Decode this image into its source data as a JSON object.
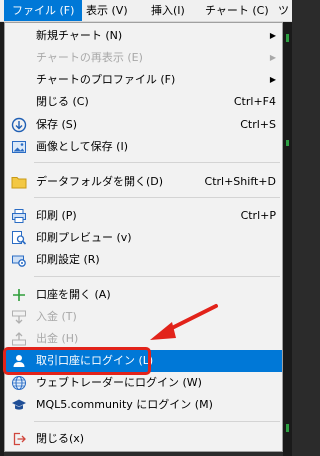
{
  "menubar": {
    "items": [
      {
        "label": "ファイル (F)",
        "active": true
      },
      {
        "label": "表示 (V)"
      },
      {
        "label": "挿入(I)"
      },
      {
        "label": "チャート (C)"
      },
      {
        "label": "ツ"
      }
    ]
  },
  "file_menu": {
    "new_chart": "新規チャート (N)",
    "chart_redisplay": "チャートの再表示 (E)",
    "chart_profile": "チャートのプロファイル (F)",
    "close": "閉じる (C)",
    "close_shortcut": "Ctrl+F4",
    "save": "保存 (S)",
    "save_shortcut": "Ctrl+S",
    "save_as_image": "画像として保存 (I)",
    "open_data_folder": "データフォルダを開く(D)",
    "open_data_folder_shortcut": "Ctrl+Shift+D",
    "print": "印刷 (P)",
    "print_shortcut": "Ctrl+P",
    "print_preview": "印刷プレビュー (v)",
    "print_setup": "印刷設定 (R)",
    "open_account": "口座を開く (A)",
    "deposit": "入金 (T)",
    "withdraw": "出金 (H)",
    "login_trade_account": "取引口座にログイン (L)",
    "login_web_trader": "ウェブトレーダーにログイン (W)",
    "login_mql5": "MQL5.community にログイン (M)",
    "exit": "閉じる(x)"
  },
  "colors": {
    "highlight": "#0078d7",
    "callout": "#e2231a",
    "chart_green": "#2ea043"
  }
}
